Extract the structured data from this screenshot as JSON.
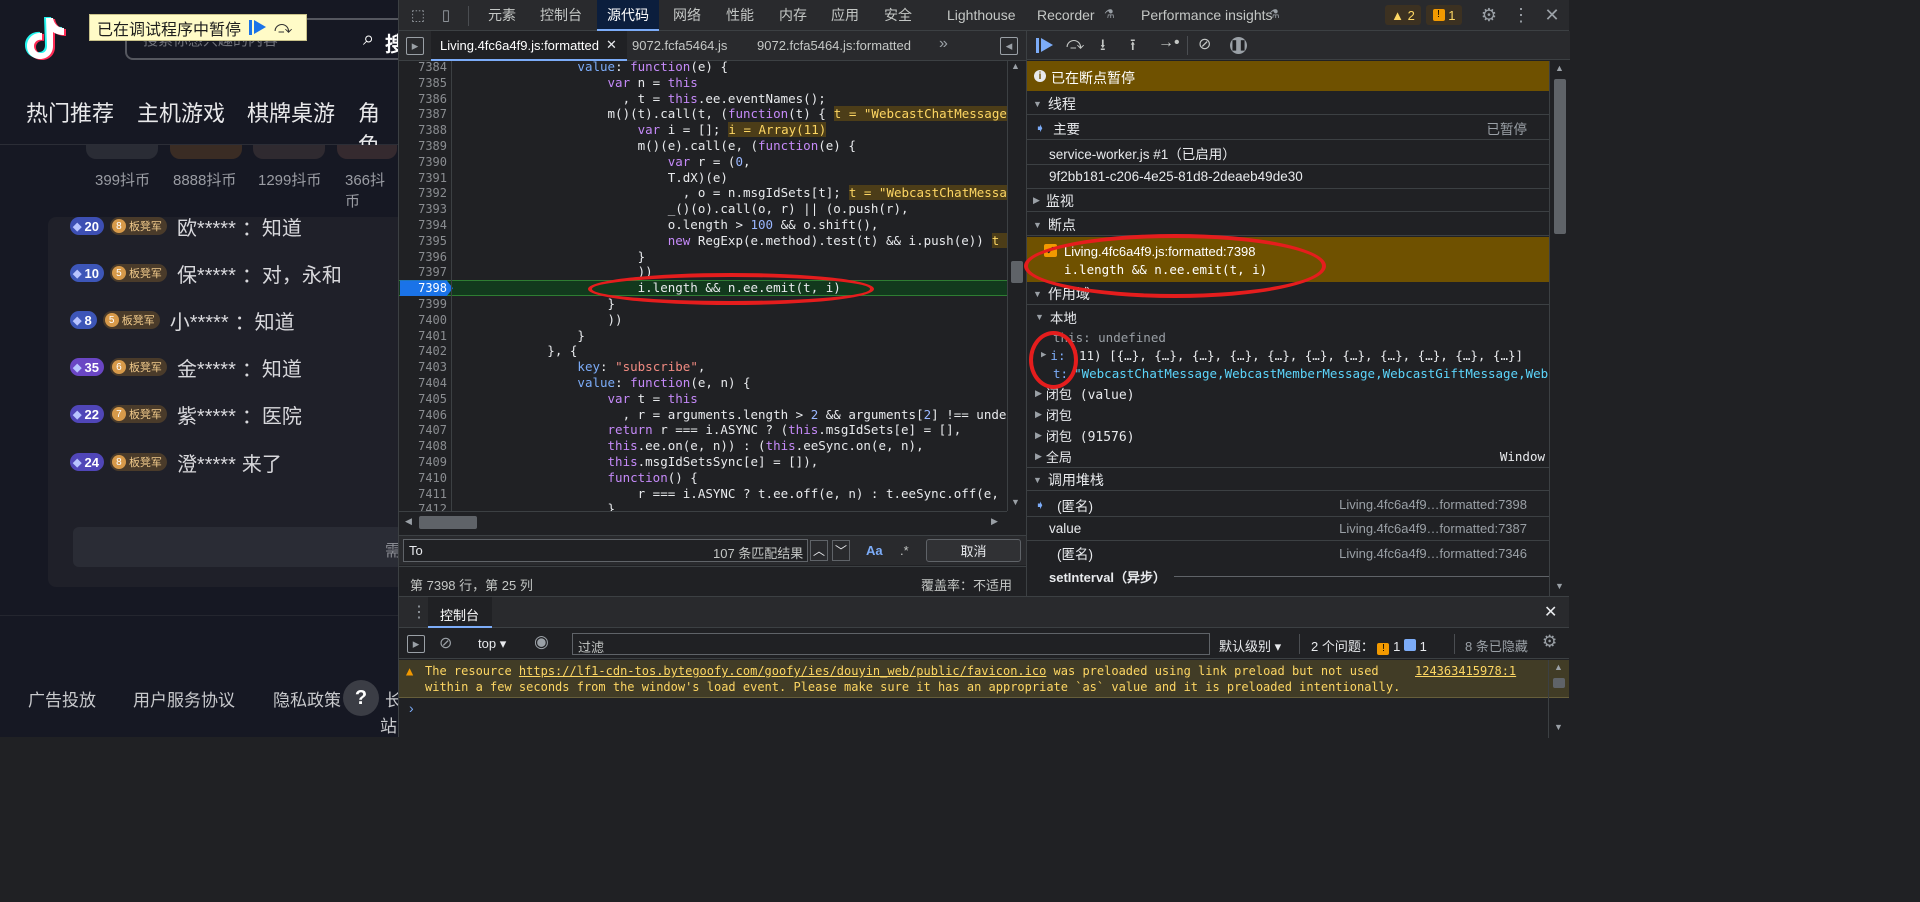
{
  "page": {
    "paused_banner": "已在调试程序中暂停",
    "search_placeholder": "搜索你感兴趣的内容",
    "search_button": "搜",
    "categories": [
      "热门推荐",
      "主机游戏",
      "棋牌桌游",
      "角色"
    ],
    "gift_prices": [
      "399抖币",
      "8888抖币",
      "1299抖币",
      "366抖币"
    ],
    "chat": [
      {
        "level": "20",
        "fan_level": "8",
        "fan_name": "板凳军",
        "user": "欧*****",
        "msg": "：知道"
      },
      {
        "level": "10",
        "fan_level": "5",
        "fan_name": "板凳军",
        "user": "保*****",
        "msg": "：对，永和"
      },
      {
        "level": "8",
        "fan_level": "5",
        "fan_name": "板凳军",
        "user": "小*****",
        "msg": "：知道"
      },
      {
        "level": "35",
        "fan_level": "6",
        "fan_name": "板凳军",
        "user": "金*****",
        "msg": "：知道"
      },
      {
        "level": "22",
        "fan_level": "7",
        "fan_name": "板凳军",
        "user": "紫*****",
        "msg": "：医院"
      },
      {
        "level": "24",
        "fan_level": "8",
        "fan_name": "板凳军",
        "user": "澄*****",
        "msg": " 来了"
      }
    ],
    "input_partial": "需",
    "footer_links": [
      "广告投放",
      "用户服务协议",
      "隐私政策",
      "长"
    ],
    "footer_partial": "站"
  },
  "devtools": {
    "tabs": [
      "元素",
      "控制台",
      "源代码",
      "网络",
      "性能",
      "内存",
      "应用",
      "安全",
      "Lighthouse",
      "Recorder",
      "Performance insights"
    ],
    "warn_count": "2",
    "issue_count": "1",
    "source_tabs": [
      "Living.4fc6a4f9.js:formatted",
      "9072.fcfa5464.js",
      "9072.fcfa5464.js:formatted"
    ],
    "code_lines": [
      {
        "n": "7384",
        "t": "                value: function(e) {"
      },
      {
        "n": "7385",
        "t": "                    var n = this"
      },
      {
        "n": "7386",
        "t": "                      , t = this.ee.eventNames();"
      },
      {
        "n": "7387",
        "t": "                    m()(t).call(t, (function(t) {",
        "inline": "t = \"WebcastChatMessage,W"
      },
      {
        "n": "7388",
        "t": "                        var i = [];",
        "inline": "i = Array(11)"
      },
      {
        "n": "7389",
        "t": "                        m()(e).call(e, (function(e) {"
      },
      {
        "n": "7390",
        "t": "                            var r = (0,"
      },
      {
        "n": "7391",
        "t": "                            T.dX)(e)"
      },
      {
        "n": "7392",
        "t": "                              , o = n.msgIdSets[t];",
        "inline": "t = \"WebcastChatMessage"
      },
      {
        "n": "7393",
        "t": "                            _()(o).call(o, r) || (o.push(r),"
      },
      {
        "n": "7394",
        "t": "                            o.length > 100 && o.shift(),"
      },
      {
        "n": "7395",
        "t": "                            new RegExp(e.method).test(t) && i.push(e))",
        "inline": "t ="
      },
      {
        "n": "7396",
        "t": "                        }"
      },
      {
        "n": "7397",
        "t": "                        ))"
      },
      {
        "n": "7398",
        "t": "                        i.length && n.ee.emit(t, i)"
      },
      {
        "n": "7399",
        "t": "                    }"
      },
      {
        "n": "7400",
        "t": "                    ))"
      },
      {
        "n": "7401",
        "t": "                }"
      },
      {
        "n": "7402",
        "t": "            }, {"
      },
      {
        "n": "7403",
        "t": "                key: \"subscribe\","
      },
      {
        "n": "7404",
        "t": "                value: function(e, n) {"
      },
      {
        "n": "7405",
        "t": "                    var t = this"
      },
      {
        "n": "7406",
        "t": "                      , r = arguments.length > 2 && arguments[2] !== undefin"
      },
      {
        "n": "7407",
        "t": "                    return r === i.ASYNC ? (this.msgIdSets[e] = [],"
      },
      {
        "n": "7408",
        "t": "                    this.ee.on(e, n)) : (this.eeSync.on(e, n),"
      },
      {
        "n": "7409",
        "t": "                    this.msgIdSetsSync[e] = []),"
      },
      {
        "n": "7410",
        "t": "                    function() {"
      },
      {
        "n": "7411",
        "t": "                        r === i.ASYNC ? t.ee.off(e, n) : t.eeSync.off(e, n)"
      },
      {
        "n": "7412",
        "t": "                    }"
      }
    ],
    "current_line": "7398",
    "search_value": "To",
    "match_count": "107 条匹配结果",
    "match_case": "Aa",
    "regex": ".*",
    "cancel": "取消",
    "status_position": "第 7398 行，第 25 列",
    "coverage": "覆盖率：不适用",
    "paused_label": "已在断点暂停",
    "threads_title": "线程",
    "thread_main": "主要",
    "thread_main_status": "已暂停",
    "thread_sw": "service-worker.js #1（已启用）",
    "thread_id": "9f2bb181-c206-4e25-81d8-2deaeb49de30",
    "watch_title": "监视",
    "breakpoints_title": "断点",
    "bp_location": "Living.4fc6a4f9.js:formatted:7398",
    "bp_code": "i.length && n.ee.emit(t, i)",
    "scope_title": "作用域",
    "local_title": "本地",
    "scope_this": "this: undefined",
    "scope_i_key": "i:",
    "scope_i_val": "(11) [{…}, {…}, {…}, {…}, {…}, {…}, {…}, {…}, {…}, {…}, {…}]",
    "scope_t_key": "t:",
    "scope_t_val": "\"WebcastChatMessage,WebcastMemberMessage,WebcastGiftMessage,Webca",
    "closures": [
      "闭包 (value)",
      "闭包",
      "闭包 (91576)"
    ],
    "global_label": "全局",
    "global_value": "Window",
    "callstack_title": "调用堆栈",
    "callstack": [
      {
        "name": "(匿名)",
        "loc": "Living.4fc6a4f9…formatted:7398"
      },
      {
        "name": "value",
        "loc": "Living.4fc6a4f9…formatted:7387"
      },
      {
        "name": "(匿名)",
        "loc": "Living.4fc6a4f9…formatted:7346"
      }
    ],
    "async_label": "setInterval（异步）",
    "console_tab": "控制台",
    "context": "top",
    "filter_placeholder": "过滤",
    "levels": "默认级别",
    "issues_label": "2 个问题：",
    "issues_a": "1",
    "issues_b": "1",
    "hidden": "8 条已隐藏",
    "console_msg_1": "The resource ",
    "console_link": "https://lf1-cdn-tos.bytegoofy.com/goofy/ies/douyin_web/public/favicon.ico",
    "console_msg_2": " was preloaded using link preload but not used",
    "console_msg_3": "within a few seconds from the window's load event. Please make sure it has an appropriate `as` value and it is preloaded intentionally.",
    "console_source": "124363415978:1"
  }
}
